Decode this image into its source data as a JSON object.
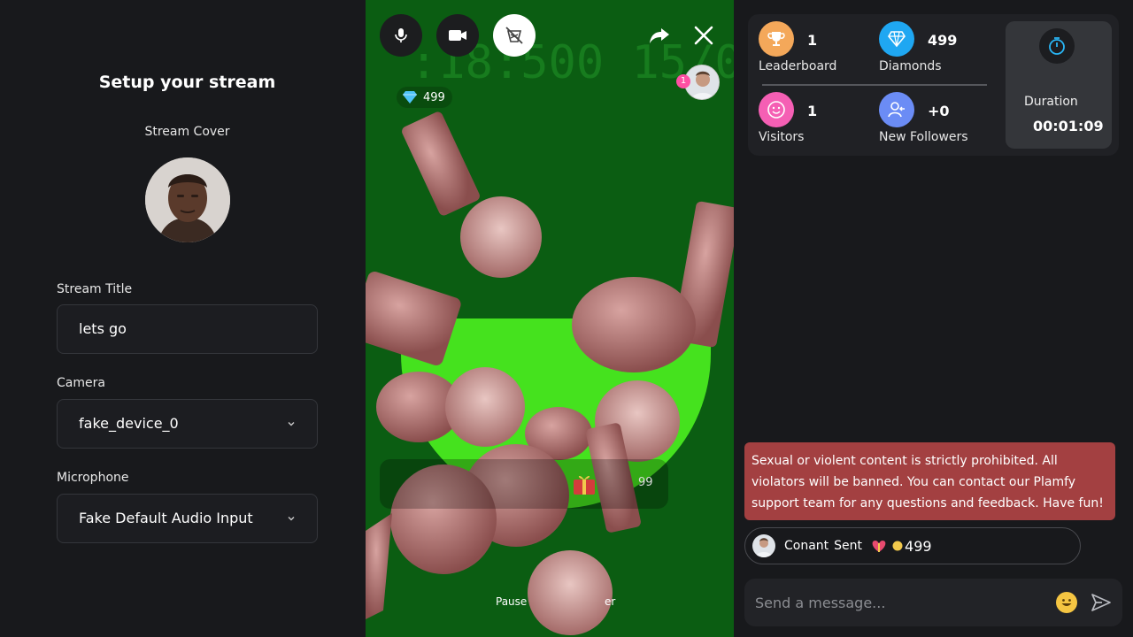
{
  "setup": {
    "title": "Setup your stream",
    "cover_label": "Stream Cover",
    "stream_title_label": "Stream Title",
    "stream_title_value": "lets go",
    "camera_label": "Camera",
    "camera_value": "fake_device_0",
    "microphone_label": "Microphone",
    "microphone_value": "Fake Default Audio Input"
  },
  "video": {
    "diamonds": "499",
    "viewer_count": "1",
    "pause_label": "Pause",
    "other_label": "er",
    "gift_amount": "99"
  },
  "stats": {
    "leaderboard_value": "1",
    "leaderboard_label": "Leaderboard",
    "diamonds_value": "499",
    "diamonds_label": "Diamonds",
    "visitors_value": "1",
    "visitors_label": "Visitors",
    "followers_value": "+0",
    "followers_label": "New Followers",
    "duration_label": "Duration",
    "duration_value": "00:01:09"
  },
  "chat": {
    "warning": "Sexual or violent content is strictly prohibited. All violators will be banned. You can contact our Plamfy support team for any questions and feedback. Have fun!",
    "gift_user": "Conant",
    "gift_action": "Sent",
    "gift_amount": "499",
    "placeholder": "Send a message..."
  },
  "colors": {
    "leaderboard": "#f4a85a",
    "diamonds": "#1fa7f2",
    "visitors": "#f55fb4",
    "followers": "#6b8cf5",
    "warning_bg": "#a34041",
    "video_bg": "#0b5d12"
  }
}
